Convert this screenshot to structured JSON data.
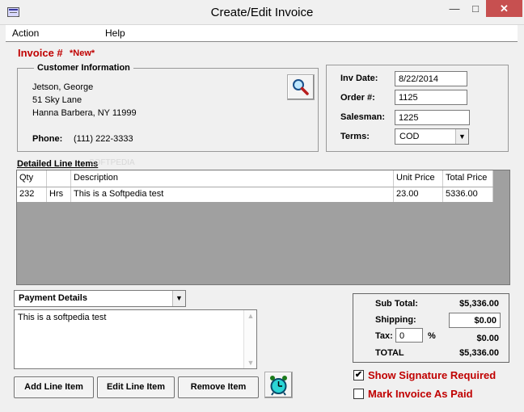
{
  "window": {
    "title": "Create/Edit Invoice"
  },
  "menu": {
    "items": [
      "Action",
      "Help"
    ]
  },
  "invoice": {
    "label": "Invoice #",
    "status": "*New*"
  },
  "customer": {
    "group_title": "Customer Information",
    "name": "Jetson, George",
    "address1": "51 Sky Lane",
    "address2": "Hanna Barbera, NY 11999",
    "phone_label": "Phone:",
    "phone": "(111) 222-3333"
  },
  "details": {
    "inv_date_label": "Inv Date:",
    "inv_date": "8/22/2014",
    "order_label": "Order #:",
    "order": "1125",
    "salesman_label": "Salesman:",
    "salesman": "1225",
    "terms_label": "Terms:",
    "terms": "COD"
  },
  "line_items": {
    "section_label": "Detailed Line Items",
    "columns": [
      "Qty",
      "",
      "Description",
      "Unit Price",
      "Total Price"
    ],
    "rows": [
      {
        "qty": "232",
        "unit": "Hrs",
        "description": "This is a Softpedia test",
        "unit_price": "23.00",
        "total_price": "5336.00"
      }
    ]
  },
  "payment": {
    "selected": "Payment Details",
    "notes": "This is a softpedia test"
  },
  "buttons": {
    "add_line": "Add Line Item",
    "edit_line": "Edit Line Item",
    "remove_item": "Remove Item"
  },
  "totals": {
    "subtotal_label": "Sub Total:",
    "subtotal": "$5,336.00",
    "shipping_label": "Shipping:",
    "shipping": "$0.00",
    "tax_label": "Tax:",
    "tax_rate": "0",
    "tax_pct": "%",
    "tax": "$0.00",
    "total_label": "TOTAL",
    "total": "$5,336.00"
  },
  "options": {
    "signature_label": "Show Signature Required",
    "signature_checked": true,
    "paid_label": "Mark Invoice As Paid",
    "paid_checked": false
  },
  "icons": {
    "app": "app-window-icon",
    "search": "magnifier-icon",
    "alarm": "alarm-clock-icon"
  },
  "colors": {
    "accent_red": "#c00000",
    "grid_bg": "#a0a0a0",
    "close_button": "#c75050"
  }
}
